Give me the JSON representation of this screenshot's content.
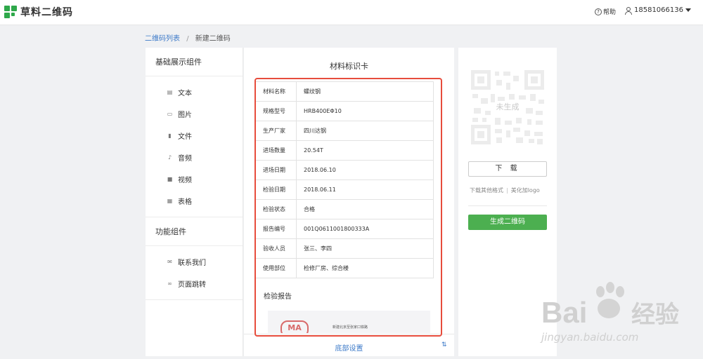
{
  "header": {
    "app_name": "草料二维码",
    "help_label": "帮助",
    "user_phone": "18581066136"
  },
  "breadcrumb": {
    "parent": "二维码列表",
    "separator": "/",
    "current": "新建二维码"
  },
  "sidebar": {
    "groups": [
      {
        "title": "基础展示组件",
        "items": [
          {
            "label": "文本",
            "icon": "file-text-icon"
          },
          {
            "label": "图片",
            "icon": "image-icon"
          },
          {
            "label": "文件",
            "icon": "file-icon"
          },
          {
            "label": "音频",
            "icon": "microphone-icon"
          },
          {
            "label": "视频",
            "icon": "video-camera-icon"
          },
          {
            "label": "表格",
            "icon": "table-icon"
          }
        ]
      },
      {
        "title": "功能组件",
        "items": [
          {
            "label": "联系我们",
            "icon": "envelope-icon"
          },
          {
            "label": "页面跳转",
            "icon": "link-icon"
          }
        ]
      }
    ]
  },
  "card": {
    "title": "材料标识卡",
    "rows": [
      {
        "key": "材料名称",
        "value": "螺纹钢"
      },
      {
        "key": "规格型号",
        "value": "HRB400EΦ10"
      },
      {
        "key": "生产厂家",
        "value": "四川达钢"
      },
      {
        "key": "进场数量",
        "value": "20.54T"
      },
      {
        "key": "进场日期",
        "value": "2018.06.10"
      },
      {
        "key": "检验日期",
        "value": "2018.06.11"
      },
      {
        "key": "检验状态",
        "value": "合格"
      },
      {
        "key": "报告编号",
        "value": "001Q0611001800333A"
      },
      {
        "key": "验收人员",
        "value": "张三、李四"
      },
      {
        "key": "使用部位",
        "value": "检修厂房、综合楼"
      }
    ],
    "report_title": "检验报告",
    "report_stamp": "MA",
    "report_header": "新建北京至张家口铁路"
  },
  "bottom_bar": {
    "label": "底部设置",
    "icon": "sort-arrows-icon"
  },
  "right_panel": {
    "qr_placeholder": "未生成",
    "download_label": "下 载",
    "other_formats": "下载其他格式",
    "link_separator": "|",
    "beautify_logo": "美化加logo",
    "generate_label": "生成二维码"
  },
  "colors": {
    "brand_green": "#2ea84a",
    "button_green": "#4caf50",
    "link_blue": "#3b79c8",
    "highlight_red": "#e74c3c"
  },
  "watermark": {
    "brand": "Bai du 经验",
    "url": "jingyan.baidu.com"
  }
}
